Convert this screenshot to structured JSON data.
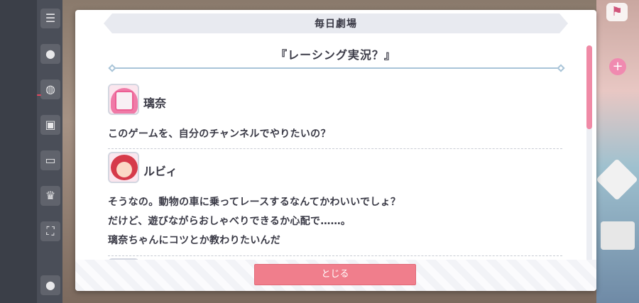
{
  "modal": {
    "header": "毎日劇場",
    "story_title": "『レーシング実況？』",
    "close_label": "とじる"
  },
  "entries": [
    {
      "speaker": "璃奈",
      "lines": [
        "このゲームを、自分のチャンネルでやりたいの？"
      ]
    },
    {
      "speaker": "ルビィ",
      "lines": [
        "そうなの。動物の車に乗ってレースするなんてかわいいでしょ？",
        "だけど、遊びながらおしゃべりできるか心配で……。",
        "璃奈ちゃんにコツとか教わりたいんだ"
      ]
    }
  ],
  "icons": {
    "menu": "menu-icon",
    "chat": "chat-icon",
    "gift": "gift-icon",
    "screen": "screen-icon",
    "trophy": "trophy-icon",
    "expand": "expand-icon",
    "user": "user-icon",
    "corner": "corner-icon",
    "plus": "plus-icon"
  }
}
